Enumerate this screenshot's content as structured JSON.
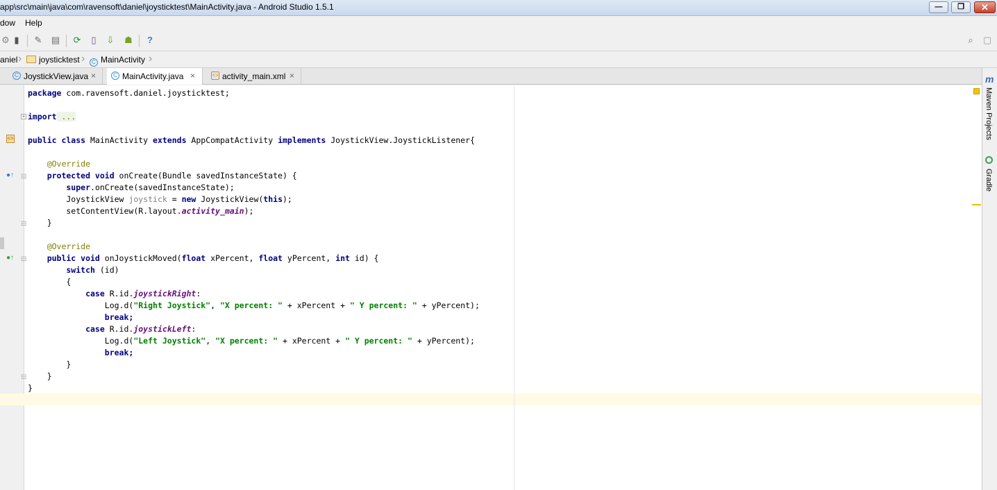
{
  "window": {
    "title": "app\\src\\main\\java\\com\\ravensoft\\daniel\\joysticktest\\MainActivity.java - Android Studio 1.5.1",
    "min_label": "—",
    "max_label": "❐",
    "close_label": "✕"
  },
  "menu": {
    "items": [
      {
        "label": "dow"
      },
      {
        "label": "Help"
      }
    ]
  },
  "breadcrumbs": [
    "aniel",
    "joysticktest",
    "MainActivity"
  ],
  "tabs": [
    {
      "label": "JoystickView.java",
      "type": "java",
      "active": false
    },
    {
      "label": "MainActivity.java",
      "type": "java",
      "active": true
    },
    {
      "label": "activity_main.xml",
      "type": "xml",
      "active": false
    }
  ],
  "tab_close": "×",
  "tool_windows": [
    "Maven Projects",
    "Gradle"
  ],
  "code": {
    "l1_a": "package",
    "l1_b": " com.ravensoft.daniel.joysticktest;",
    "l3_a": "import",
    "l3_b": " ...",
    "l5_a": "public class",
    "l5_b": " MainActivity ",
    "l5_c": "extends",
    "l5_d": " AppCompatActivity ",
    "l5_e": "implements",
    "l5_f": " JoystickView.JoystickListener{",
    "l7": "    @Override",
    "l8_a": "    protected void",
    "l8_b": " onCreate(Bundle savedInstanceState) {",
    "l9_a": "        super",
    "l9_b": ".onCreate(savedInstanceState);",
    "l10_a": "        JoystickView ",
    "l10_b": "joystick",
    "l10_c": " = ",
    "l10_d": "new",
    "l10_e": " JoystickView(",
    "l10_f": "this",
    "l10_g": ");",
    "l11_a": "        setContentView(R.layout.",
    "l11_b": "activity_main",
    "l11_c": ");",
    "l12": "    }",
    "l14": "    @Override",
    "l15_a": "    public void",
    "l15_b": " onJoystickMoved(",
    "l15_c": "float",
    "l15_d": " xPercent, ",
    "l15_e": "float",
    "l15_f": " yPercent, ",
    "l15_g": "int",
    "l15_h": " id) {",
    "l16_a": "        switch",
    "l16_b": " (id)",
    "l17": "        {",
    "l18_a": "            case",
    "l18_b": " R.id.",
    "l18_c": "joystickRight",
    "l18_d": ":",
    "l19_a": "                Log.d(",
    "l19_b": "\"Right Joystick\"",
    "l19_c": ", ",
    "l19_d": "\"X percent: \"",
    "l19_e": " + xPercent + ",
    "l19_f": "\" Y percent: \"",
    "l19_g": " + yPercent);",
    "l20": "                break;",
    "l21_a": "            case",
    "l21_b": " R.id.",
    "l21_c": "joystickLeft",
    "l21_d": ":",
    "l22_a": "                Log.d(",
    "l22_b": "\"Left Joystick\"",
    "l22_c": ", ",
    "l22_d": "\"X percent: \"",
    "l22_e": " + xPercent + ",
    "l22_f": "\" Y percent: \"",
    "l22_g": " + yPercent);",
    "l23": "                break;",
    "l24": "        }",
    "l25": "    }",
    "l26": "}"
  },
  "colors": {
    "keyword": "#000080",
    "annotation": "#808000",
    "string": "#008000",
    "field": "#660e7a",
    "caret_row": "#fffae3"
  }
}
